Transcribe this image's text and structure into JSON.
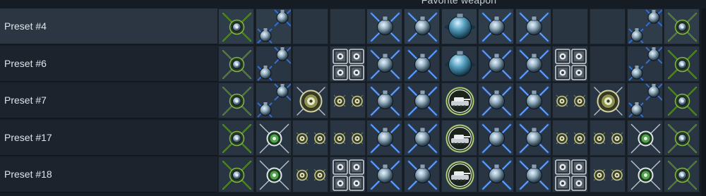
{
  "header": {
    "title": "Favorite weapon"
  },
  "rows": [
    {
      "label": "Preset #4",
      "selected": true,
      "slots": [
        "gun-pod-x-green",
        "rocket-pair",
        "empty",
        "empty",
        "bomb-x-blue",
        "bomb-x-blue",
        "large-bomb",
        "bomb-x-blue",
        "bomb-x-blue",
        "empty",
        "empty",
        "rocket-pair",
        "gun-pod-x-green"
      ]
    },
    {
      "label": "Preset #6",
      "selected": false,
      "slots": [
        "gun-pod-x-green",
        "rocket-pair",
        "empty",
        "quad-launcher",
        "bomb-x-blue",
        "bomb-x-blue",
        "large-bomb",
        "bomb-x-blue",
        "bomb-x-blue",
        "quad-launcher",
        "empty",
        "rocket-pair",
        "gun-pod-x-green"
      ]
    },
    {
      "label": "Preset #7",
      "selected": false,
      "slots": [
        "gun-pod-x-green",
        "rocket-pair",
        "rocket-pod-large",
        "twin-gun-pods",
        "bomb-x-blue",
        "bomb-x-blue",
        "tank-target-pod",
        "bomb-x-blue",
        "bomb-x-blue",
        "twin-gun-pods",
        "rocket-pod-large",
        "rocket-pair",
        "gun-pod-x-green"
      ]
    },
    {
      "label": "Preset #17",
      "selected": false,
      "slots": [
        "gun-pod-x-green",
        "missile-x-green",
        "twin-gun-pods",
        "twin-gun-pods",
        "bomb-x-blue",
        "bomb-x-blue",
        "tank-target-pod",
        "bomb-x-blue",
        "bomb-x-blue",
        "twin-gun-pods",
        "twin-gun-pods",
        "missile-x-green",
        "gun-pod-x-green"
      ]
    },
    {
      "label": "Preset #18",
      "selected": false,
      "slots": [
        "gun-pod-x-green",
        "missile-x-green",
        "twin-gun-pods",
        "quad-launcher",
        "bomb-x-blue",
        "bomb-x-blue",
        "tank-target-pod",
        "bomb-x-blue",
        "bomb-x-blue",
        "quad-launcher",
        "twin-gun-pods",
        "missile-x-green",
        "gun-pod-x-green"
      ]
    }
  ],
  "colors": {
    "background": "#151c24",
    "label_bg": "#1c232d",
    "selected_bg": "#2b3642",
    "cell_bg": "#293543",
    "green_accent": "#6aa830",
    "blue_accent": "#2f6fd6"
  }
}
